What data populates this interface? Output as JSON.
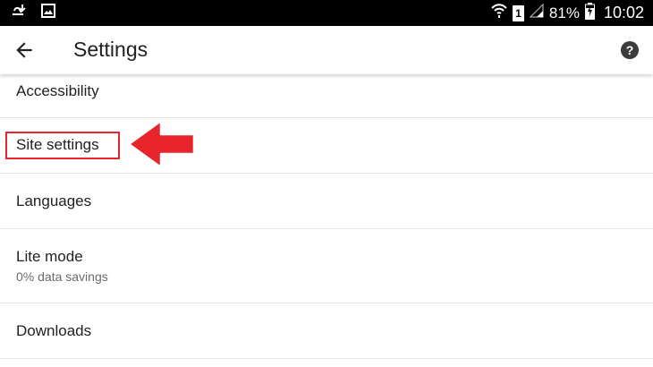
{
  "status_bar": {
    "battery_percent": "81%",
    "time": "10:02",
    "sim_label": "1",
    "icons": [
      "usb-debug-icon",
      "gallery-notification-icon",
      "wifi-icon",
      "sim-icon",
      "signal-icon",
      "battery-charging-icon"
    ]
  },
  "app_bar": {
    "title": "Settings",
    "back_icon": "arrow-back-icon",
    "help_icon": "help-icon"
  },
  "settings": {
    "items": [
      {
        "title": "Accessibility"
      },
      {
        "title": "Site settings"
      },
      {
        "title": "Languages"
      },
      {
        "title": "Lite mode",
        "subtitle": "0% data savings"
      },
      {
        "title": "Downloads"
      }
    ]
  },
  "annotation": {
    "highlighted_item": "Site settings",
    "color": "#e8242c"
  },
  "colors": {
    "status_bar_bg": "#000000",
    "app_bar_bg": "#ffffff",
    "text_primary": "#202124",
    "text_secondary": "#6b6b6b",
    "divider": "#e6e6e6"
  }
}
